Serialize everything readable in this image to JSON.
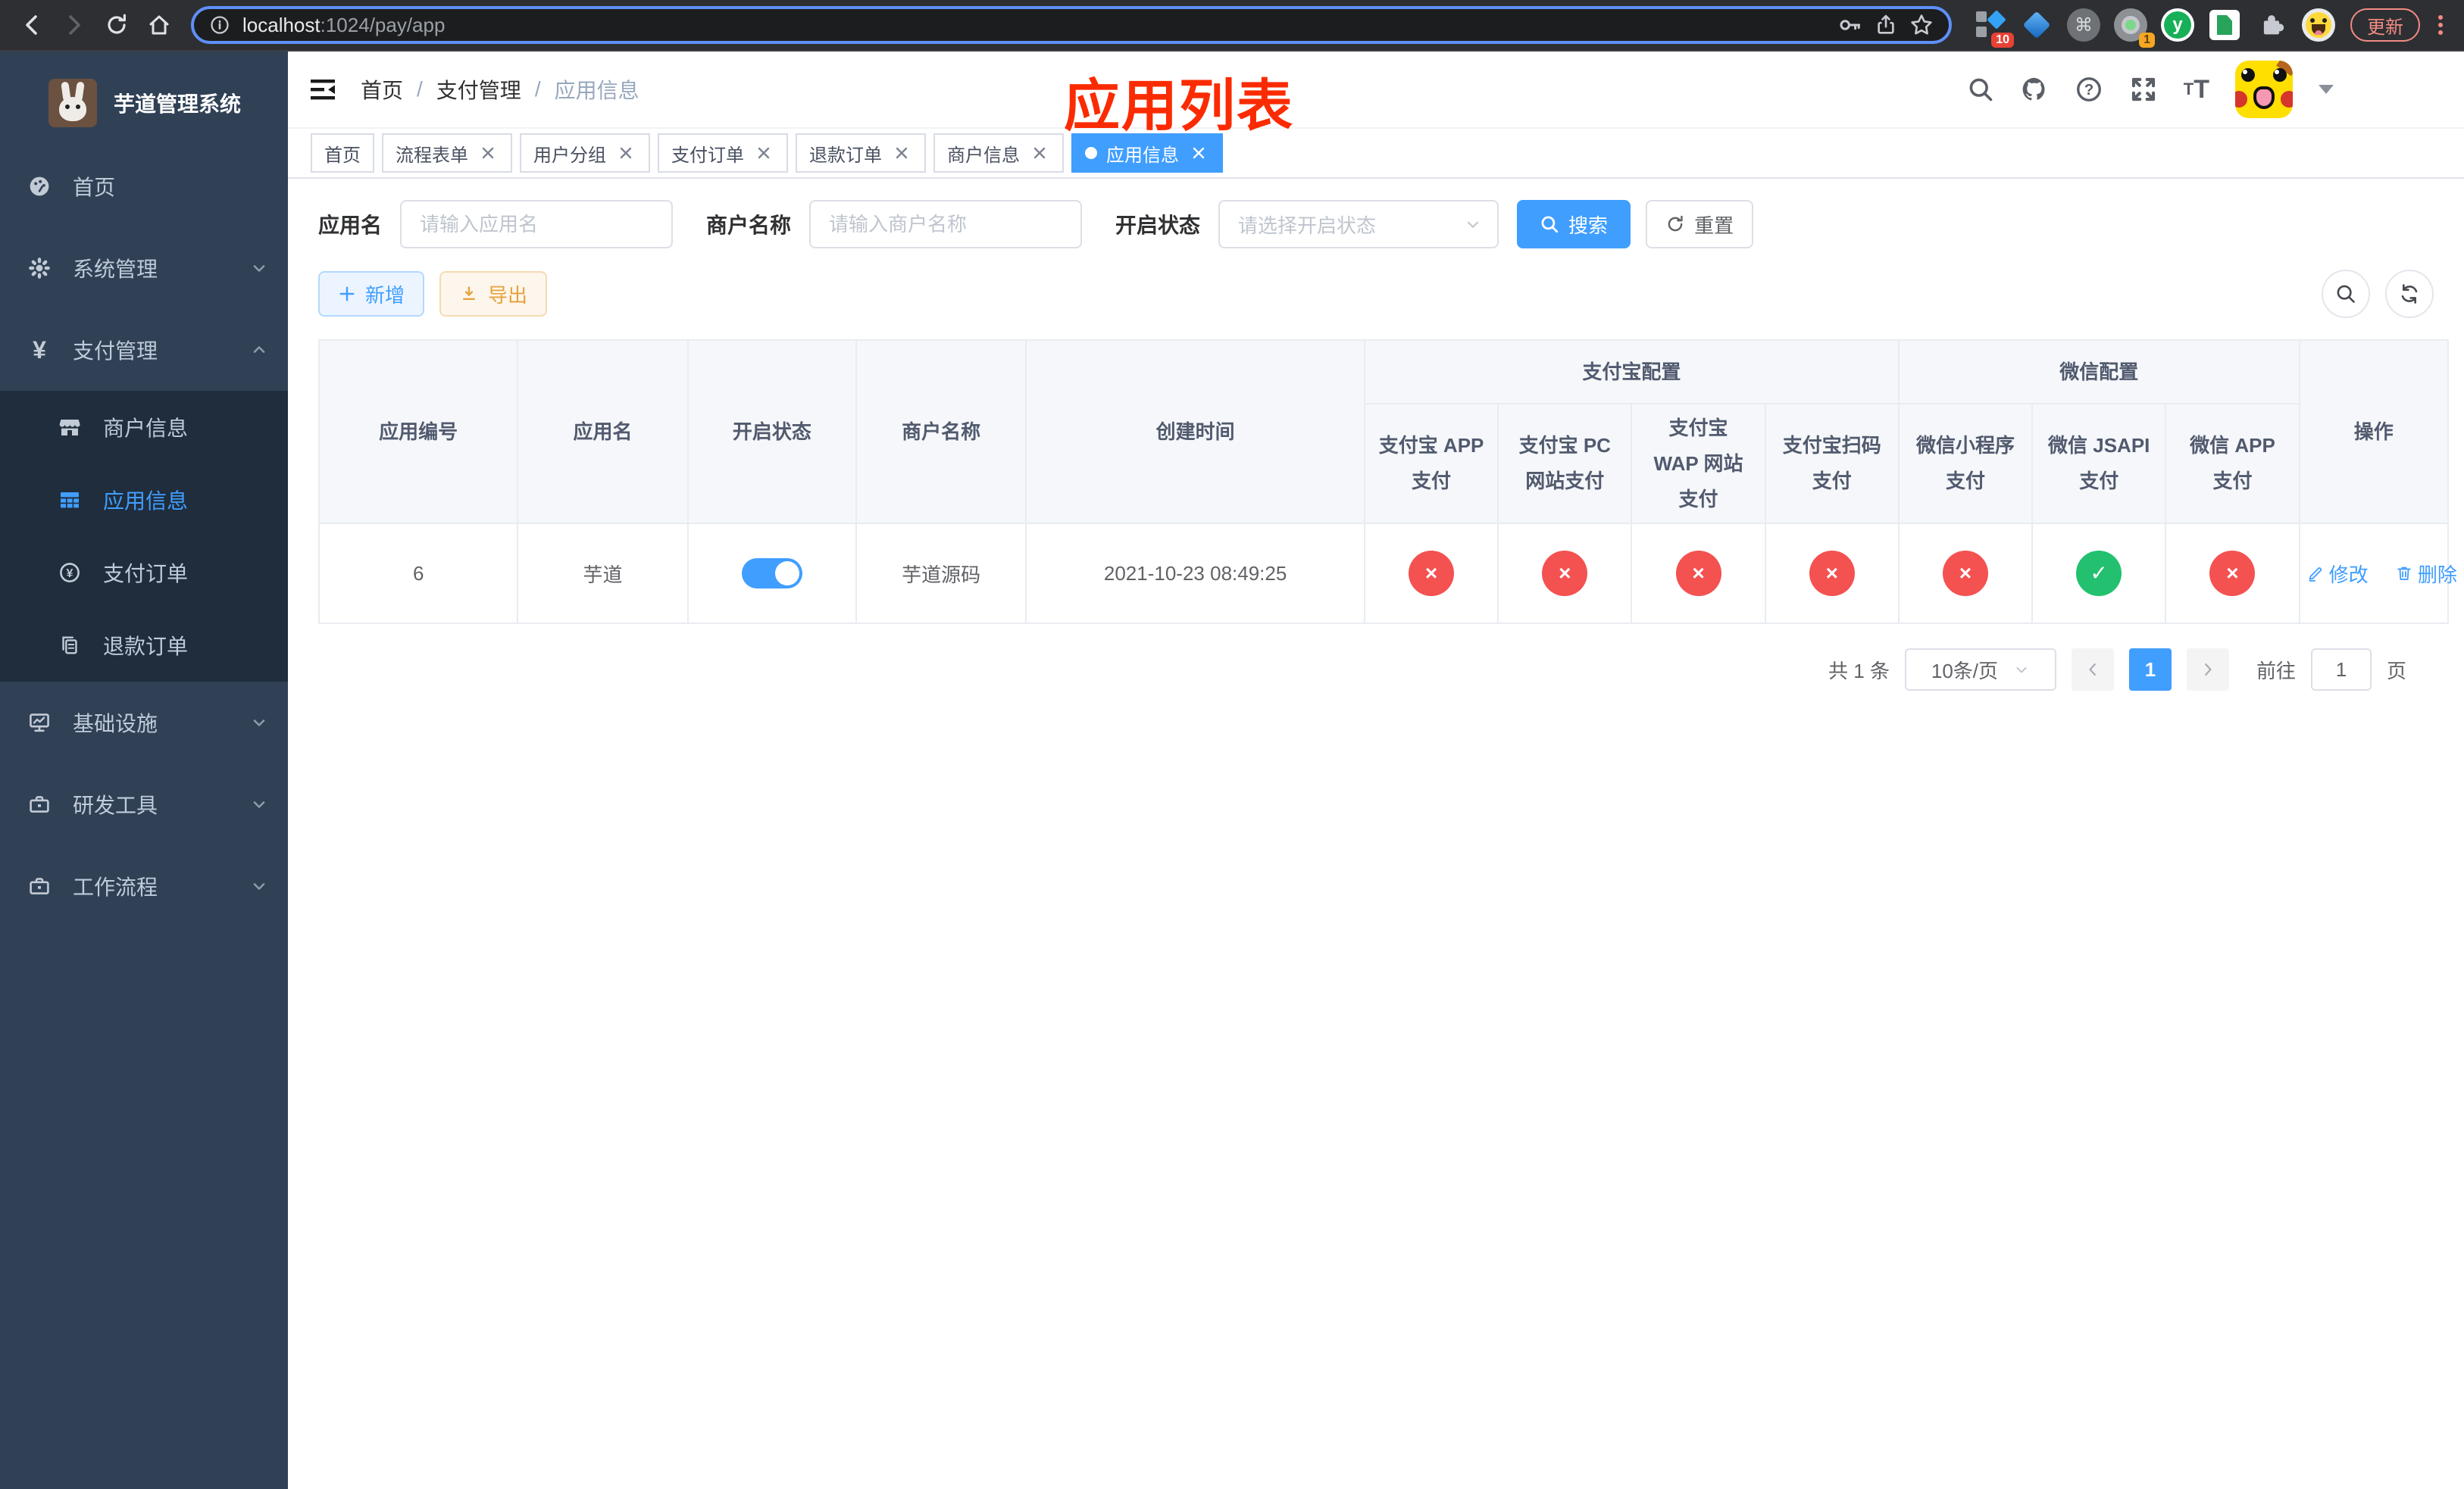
{
  "browser": {
    "url_host": "localhost",
    "url_path": ":1024/pay/app",
    "update_label": "更新",
    "badges": {
      "blocks": "10",
      "target": "1"
    },
    "ext_y_label": "y",
    "cmd_glyph": "⌘"
  },
  "sidebar": {
    "title": "芋道管理系统",
    "menu": [
      {
        "label": "首页"
      },
      {
        "label": "系统管理"
      },
      {
        "label": "支付管理"
      },
      {
        "label": "商户信息"
      },
      {
        "label": "应用信息"
      },
      {
        "label": "支付订单"
      },
      {
        "label": "退款订单"
      },
      {
        "label": "基础设施"
      },
      {
        "label": "研发工具"
      },
      {
        "label": "工作流程"
      }
    ]
  },
  "navbar": {
    "breadcrumb": [
      "首页",
      "支付管理",
      "应用信息"
    ],
    "separator": "/"
  },
  "annotation": {
    "text": "应用列表",
    "color": "#fb2b01"
  },
  "tags": [
    {
      "label": "首页",
      "closable": false,
      "active": false
    },
    {
      "label": "流程表单",
      "closable": true,
      "active": false
    },
    {
      "label": "用户分组",
      "closable": true,
      "active": false
    },
    {
      "label": "支付订单",
      "closable": true,
      "active": false
    },
    {
      "label": "退款订单",
      "closable": true,
      "active": false
    },
    {
      "label": "商户信息",
      "closable": true,
      "active": false
    },
    {
      "label": "应用信息",
      "closable": true,
      "active": true
    }
  ],
  "filters": {
    "app_name_label": "应用名",
    "app_name_placeholder": "请输入应用名",
    "merchant_label": "商户名称",
    "merchant_placeholder": "请输入商户名称",
    "status_label": "开启状态",
    "status_placeholder": "请选择开启状态",
    "search_label": "搜索",
    "reset_label": "重置"
  },
  "toolbar": {
    "add_label": "新增",
    "export_label": "导出"
  },
  "table": {
    "headers": {
      "app_id": "应用编号",
      "app_name": "应用名",
      "status": "开启状态",
      "merchant": "商户名称",
      "create_time": "创建时间",
      "alipay_group": "支付宝配置",
      "wechat_group": "微信配置",
      "ops": "操作"
    },
    "config_columns": [
      "支付宝 APP 支付",
      "支付宝 PC 网站支付",
      "支付宝 WAP 网站支付",
      "支付宝扫码支付",
      "微信小程序支付",
      "微信 JSAPI 支付",
      "微信 APP 支付"
    ],
    "row": {
      "app_id": "6",
      "app_name": "芋道",
      "status_on": true,
      "merchant": "芋道源码",
      "create_time": "2021-10-23 08:49:25",
      "configs": [
        "off",
        "off",
        "off",
        "off",
        "off",
        "on",
        "off"
      ],
      "edit_label": "修改",
      "delete_label": "删除"
    }
  },
  "pagination": {
    "total": "共 1 条",
    "page_size": "10条/页",
    "current": "1",
    "goto_label": "前往",
    "goto_value": "1",
    "goto_unit": "页"
  }
}
